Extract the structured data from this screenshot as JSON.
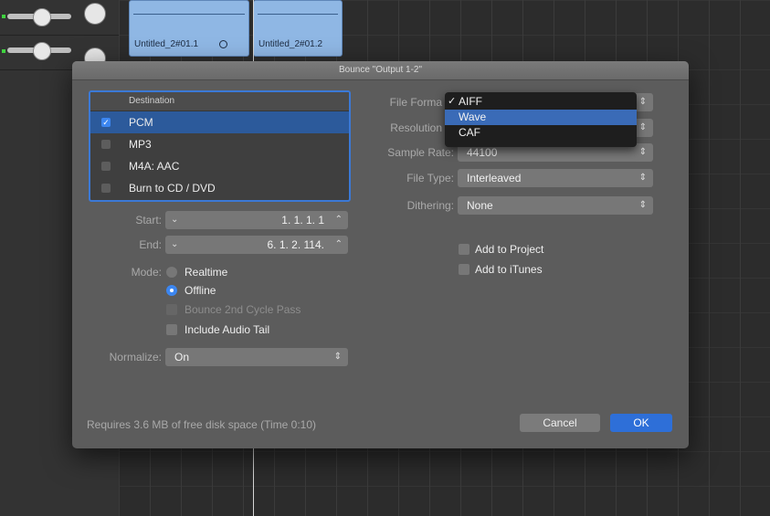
{
  "daw": {
    "regions": [
      {
        "name": "Untitled_2#01.1"
      },
      {
        "name": "Untitled_2#01.2"
      }
    ],
    "region_loop_icon": "loop-circle-icon"
  },
  "dialog": {
    "title": "Bounce \"Output 1-2\"",
    "destination": {
      "header": "Destination",
      "items": [
        {
          "label": "PCM",
          "checked": true
        },
        {
          "label": "MP3",
          "checked": false
        },
        {
          "label": "M4A: AAC",
          "checked": false
        },
        {
          "label": "Burn to CD / DVD",
          "checked": false
        }
      ]
    },
    "start": {
      "label": "Start:",
      "value": "1. 1. 1.    1"
    },
    "end": {
      "label": "End:",
      "value": "6. 1. 2. 114."
    },
    "mode": {
      "label": "Mode:",
      "realtime": "Realtime",
      "offline": "Offline",
      "selected": "Offline"
    },
    "bounce_2nd_cycle": "Bounce 2nd Cycle Pass",
    "include_audio_tail": "Include Audio Tail",
    "normalize": {
      "label": "Normalize:",
      "value": "On"
    },
    "file_format": {
      "label": "File Forma",
      "options": [
        "AIFF",
        "Wave",
        "CAF"
      ],
      "selected": "AIFF",
      "highlighted": "Wave"
    },
    "resolution": {
      "label": "Resolution"
    },
    "sample_rate": {
      "label": "Sample Rate:",
      "value": "44100"
    },
    "file_type": {
      "label": "File Type:",
      "value": "Interleaved"
    },
    "dithering": {
      "label": "Dithering:",
      "value": "None"
    },
    "add_to_project": "Add to Project",
    "add_to_itunes": "Add to iTunes",
    "footer": "Requires 3.6 MB of free disk space  (Time 0:10)",
    "buttons": {
      "cancel": "Cancel",
      "ok": "OK"
    },
    "colors": {
      "accent": "#3c86f0",
      "ok_button": "#2e6fd8",
      "selection": "#2c5a9b"
    }
  }
}
